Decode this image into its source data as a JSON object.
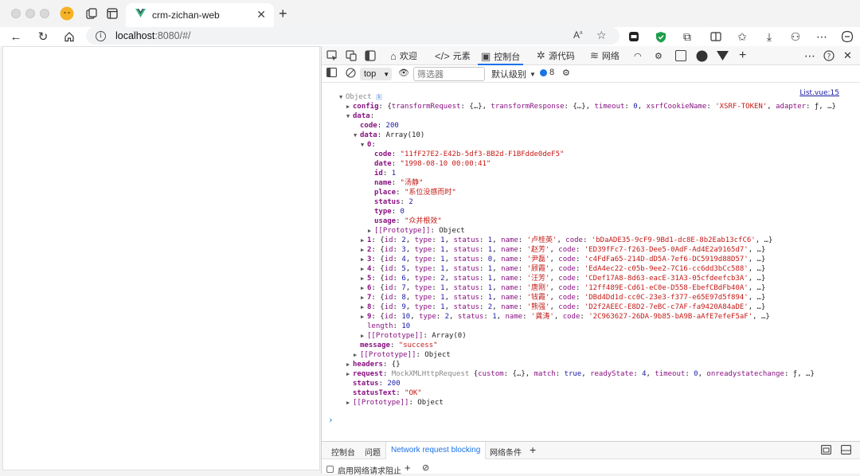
{
  "browser": {
    "tab_title": "crm-zichan-web",
    "url_host": "localhost",
    "url_rest": ":8080/#/"
  },
  "devtools": {
    "tabs": [
      {
        "label": "欢迎",
        "icon": "home-icon"
      },
      {
        "label": "元素",
        "icon": "code-icon"
      },
      {
        "label": "控制台",
        "icon": "console-icon"
      },
      {
        "label": "源代码",
        "icon": "bug-icon"
      },
      {
        "label": "网络",
        "icon": "wifi-icon"
      }
    ],
    "console_context": "top",
    "filter_placeholder": "筛选器",
    "level_label": "默认级别",
    "issue_count": "8",
    "source_link": "List.vue:15"
  },
  "console_lines": [
    {
      "indent": 0,
      "tri": "▼",
      "segs": [
        [
          "g",
          "Object "
        ],
        [
          "badge",
          "i"
        ]
      ]
    },
    {
      "indent": 1,
      "tri": "▶",
      "segs": [
        [
          "k",
          "config"
        ],
        [
          "p",
          ": {"
        ],
        [
          "kk",
          "transformRequest"
        ],
        [
          "p",
          ": {…}, "
        ],
        [
          "kk",
          "transformResponse"
        ],
        [
          "p",
          ": {…}, "
        ],
        [
          "kk",
          "timeout"
        ],
        [
          "p",
          ": "
        ],
        [
          "n",
          "0"
        ],
        [
          "p",
          ", "
        ],
        [
          "kk",
          "xsrfCookieName"
        ],
        [
          "p",
          ": "
        ],
        [
          "s",
          "'XSRF-TOKEN'"
        ],
        [
          "p",
          ", "
        ],
        [
          "kk",
          "adapter"
        ],
        [
          "p",
          ": ƒ, …}"
        ]
      ]
    },
    {
      "indent": 1,
      "tri": "▼",
      "segs": [
        [
          "k",
          "data"
        ],
        [
          "p",
          ":"
        ]
      ]
    },
    {
      "indent": 2,
      "tri": "",
      "segs": [
        [
          "k",
          "code"
        ],
        [
          "p",
          ": "
        ],
        [
          "n",
          "200"
        ]
      ]
    },
    {
      "indent": 2,
      "tri": "▼",
      "segs": [
        [
          "k",
          "data"
        ],
        [
          "p",
          ": Array(10)"
        ]
      ]
    },
    {
      "indent": 3,
      "tri": "▼",
      "segs": [
        [
          "k",
          "0"
        ],
        [
          "p",
          ":"
        ]
      ]
    },
    {
      "indent": 4,
      "tri": "",
      "segs": [
        [
          "k",
          "code"
        ],
        [
          "p",
          ": "
        ],
        [
          "s",
          "\"11fF27E2-E42b-5df3-BB2d-F1BFdde0deF5\""
        ]
      ]
    },
    {
      "indent": 4,
      "tri": "",
      "segs": [
        [
          "k",
          "date"
        ],
        [
          "p",
          ": "
        ],
        [
          "s",
          "\"1998-08-10 00:00:41\""
        ]
      ]
    },
    {
      "indent": 4,
      "tri": "",
      "segs": [
        [
          "k",
          "id"
        ],
        [
          "p",
          ": "
        ],
        [
          "n",
          "1"
        ]
      ]
    },
    {
      "indent": 4,
      "tri": "",
      "segs": [
        [
          "k",
          "name"
        ],
        [
          "p",
          ": "
        ],
        [
          "s",
          "\"汤静\""
        ]
      ]
    },
    {
      "indent": 4,
      "tri": "",
      "segs": [
        [
          "k",
          "place"
        ],
        [
          "p",
          ": "
        ],
        [
          "s",
          "\"系位没感而时\""
        ]
      ]
    },
    {
      "indent": 4,
      "tri": "",
      "segs": [
        [
          "k",
          "status"
        ],
        [
          "p",
          ": "
        ],
        [
          "n",
          "2"
        ]
      ]
    },
    {
      "indent": 4,
      "tri": "",
      "segs": [
        [
          "k",
          "type"
        ],
        [
          "p",
          ": "
        ],
        [
          "n",
          "0"
        ]
      ]
    },
    {
      "indent": 4,
      "tri": "",
      "segs": [
        [
          "k",
          "usage"
        ],
        [
          "p",
          ": "
        ],
        [
          "s",
          "\"众并根效\""
        ]
      ]
    },
    {
      "indent": 4,
      "tri": "▶",
      "segs": [
        [
          "kk",
          "[[Prototype]]"
        ],
        [
          "p",
          ": Object"
        ]
      ]
    },
    {
      "indent": 3,
      "tri": "▶",
      "segs": [
        [
          "k",
          "1"
        ],
        [
          "p",
          ": {"
        ],
        [
          "kk",
          "id"
        ],
        [
          "p",
          ": "
        ],
        [
          "n",
          "2"
        ],
        [
          "p",
          ", "
        ],
        [
          "kk",
          "type"
        ],
        [
          "p",
          ": "
        ],
        [
          "n",
          "1"
        ],
        [
          "p",
          ", "
        ],
        [
          "kk",
          "status"
        ],
        [
          "p",
          ": "
        ],
        [
          "n",
          "1"
        ],
        [
          "p",
          ", "
        ],
        [
          "kk",
          "name"
        ],
        [
          "p",
          ": "
        ],
        [
          "s",
          "'卢桂英'"
        ],
        [
          "p",
          ", "
        ],
        [
          "kk",
          "code"
        ],
        [
          "p",
          ": "
        ],
        [
          "s",
          "'bDaADE35-9cF9-9Bd1-dc8E-8b2Eab13cfC6'"
        ],
        [
          "p",
          ", …}"
        ]
      ]
    },
    {
      "indent": 3,
      "tri": "▶",
      "segs": [
        [
          "k",
          "2"
        ],
        [
          "p",
          ": {"
        ],
        [
          "kk",
          "id"
        ],
        [
          "p",
          ": "
        ],
        [
          "n",
          "3"
        ],
        [
          "p",
          ", "
        ],
        [
          "kk",
          "type"
        ],
        [
          "p",
          ": "
        ],
        [
          "n",
          "1"
        ],
        [
          "p",
          ", "
        ],
        [
          "kk",
          "status"
        ],
        [
          "p",
          ": "
        ],
        [
          "n",
          "1"
        ],
        [
          "p",
          ", "
        ],
        [
          "kk",
          "name"
        ],
        [
          "p",
          ": "
        ],
        [
          "s",
          "'赵芳'"
        ],
        [
          "p",
          ", "
        ],
        [
          "kk",
          "code"
        ],
        [
          "p",
          ": "
        ],
        [
          "s",
          "'ED39fFc7-f263-Dee5-0AdF-Ad4E2a9165d7'"
        ],
        [
          "p",
          ", …}"
        ]
      ]
    },
    {
      "indent": 3,
      "tri": "▶",
      "segs": [
        [
          "k",
          "3"
        ],
        [
          "p",
          ": {"
        ],
        [
          "kk",
          "id"
        ],
        [
          "p",
          ": "
        ],
        [
          "n",
          "4"
        ],
        [
          "p",
          ", "
        ],
        [
          "kk",
          "type"
        ],
        [
          "p",
          ": "
        ],
        [
          "n",
          "1"
        ],
        [
          "p",
          ", "
        ],
        [
          "kk",
          "status"
        ],
        [
          "p",
          ": "
        ],
        [
          "n",
          "0"
        ],
        [
          "p",
          ", "
        ],
        [
          "kk",
          "name"
        ],
        [
          "p",
          ": "
        ],
        [
          "s",
          "'尹磊'"
        ],
        [
          "p",
          ", "
        ],
        [
          "kk",
          "code"
        ],
        [
          "p",
          ": "
        ],
        [
          "s",
          "'c4FdFa65-214D-dD5A-7ef6-DC5919d88D57'"
        ],
        [
          "p",
          ", …}"
        ]
      ]
    },
    {
      "indent": 3,
      "tri": "▶",
      "segs": [
        [
          "k",
          "4"
        ],
        [
          "p",
          ": {"
        ],
        [
          "kk",
          "id"
        ],
        [
          "p",
          ": "
        ],
        [
          "n",
          "5"
        ],
        [
          "p",
          ", "
        ],
        [
          "kk",
          "type"
        ],
        [
          "p",
          ": "
        ],
        [
          "n",
          "1"
        ],
        [
          "p",
          ", "
        ],
        [
          "kk",
          "status"
        ],
        [
          "p",
          ": "
        ],
        [
          "n",
          "1"
        ],
        [
          "p",
          ", "
        ],
        [
          "kk",
          "name"
        ],
        [
          "p",
          ": "
        ],
        [
          "s",
          "'顾霞'"
        ],
        [
          "p",
          ", "
        ],
        [
          "kk",
          "code"
        ],
        [
          "p",
          ": "
        ],
        [
          "s",
          "'EdA4ec22-c05b-9ee2-7C16-cc6dd3bCc588'"
        ],
        [
          "p",
          ", …}"
        ]
      ]
    },
    {
      "indent": 3,
      "tri": "▶",
      "segs": [
        [
          "k",
          "5"
        ],
        [
          "p",
          ": {"
        ],
        [
          "kk",
          "id"
        ],
        [
          "p",
          ": "
        ],
        [
          "n",
          "6"
        ],
        [
          "p",
          ", "
        ],
        [
          "kk",
          "type"
        ],
        [
          "p",
          ": "
        ],
        [
          "n",
          "2"
        ],
        [
          "p",
          ", "
        ],
        [
          "kk",
          "status"
        ],
        [
          "p",
          ": "
        ],
        [
          "n",
          "1"
        ],
        [
          "p",
          ", "
        ],
        [
          "kk",
          "name"
        ],
        [
          "p",
          ": "
        ],
        [
          "s",
          "'汪芳'"
        ],
        [
          "p",
          ", "
        ],
        [
          "kk",
          "code"
        ],
        [
          "p",
          ": "
        ],
        [
          "s",
          "'CDef17A8-8d63-eacE-31A3-05cfdeefcb3A'"
        ],
        [
          "p",
          ", …}"
        ]
      ]
    },
    {
      "indent": 3,
      "tri": "▶",
      "segs": [
        [
          "k",
          "6"
        ],
        [
          "p",
          ": {"
        ],
        [
          "kk",
          "id"
        ],
        [
          "p",
          ": "
        ],
        [
          "n",
          "7"
        ],
        [
          "p",
          ", "
        ],
        [
          "kk",
          "type"
        ],
        [
          "p",
          ": "
        ],
        [
          "n",
          "1"
        ],
        [
          "p",
          ", "
        ],
        [
          "kk",
          "status"
        ],
        [
          "p",
          ": "
        ],
        [
          "n",
          "1"
        ],
        [
          "p",
          ", "
        ],
        [
          "kk",
          "name"
        ],
        [
          "p",
          ": "
        ],
        [
          "s",
          "'唐刚'"
        ],
        [
          "p",
          ", "
        ],
        [
          "kk",
          "code"
        ],
        [
          "p",
          ": "
        ],
        [
          "s",
          "'12ff489E-Cd61-eC0e-D558-EbefCBdFb40A'"
        ],
        [
          "p",
          ", …}"
        ]
      ]
    },
    {
      "indent": 3,
      "tri": "▶",
      "segs": [
        [
          "k",
          "7"
        ],
        [
          "p",
          ": {"
        ],
        [
          "kk",
          "id"
        ],
        [
          "p",
          ": "
        ],
        [
          "n",
          "8"
        ],
        [
          "p",
          ", "
        ],
        [
          "kk",
          "type"
        ],
        [
          "p",
          ": "
        ],
        [
          "n",
          "1"
        ],
        [
          "p",
          ", "
        ],
        [
          "kk",
          "status"
        ],
        [
          "p",
          ": "
        ],
        [
          "n",
          "1"
        ],
        [
          "p",
          ", "
        ],
        [
          "kk",
          "name"
        ],
        [
          "p",
          ": "
        ],
        [
          "s",
          "'钱霞'"
        ],
        [
          "p",
          ", "
        ],
        [
          "kk",
          "code"
        ],
        [
          "p",
          ": "
        ],
        [
          "s",
          "'DBd4Dd1d-cc0C-23e3-f377-e65E97d5f894'"
        ],
        [
          "p",
          ", …}"
        ]
      ]
    },
    {
      "indent": 3,
      "tri": "▶",
      "segs": [
        [
          "k",
          "8"
        ],
        [
          "p",
          ": {"
        ],
        [
          "kk",
          "id"
        ],
        [
          "p",
          ": "
        ],
        [
          "n",
          "9"
        ],
        [
          "p",
          ", "
        ],
        [
          "kk",
          "type"
        ],
        [
          "p",
          ": "
        ],
        [
          "n",
          "1"
        ],
        [
          "p",
          ", "
        ],
        [
          "kk",
          "status"
        ],
        [
          "p",
          ": "
        ],
        [
          "n",
          "2"
        ],
        [
          "p",
          ", "
        ],
        [
          "kk",
          "name"
        ],
        [
          "p",
          ": "
        ],
        [
          "s",
          "'熊强'"
        ],
        [
          "p",
          ", "
        ],
        [
          "kk",
          "code"
        ],
        [
          "p",
          ": "
        ],
        [
          "s",
          "'D2f2AEEC-E8D2-7eBC-c7AF-fa9420A84aDE'"
        ],
        [
          "p",
          ", …}"
        ]
      ]
    },
    {
      "indent": 3,
      "tri": "▶",
      "segs": [
        [
          "k",
          "9"
        ],
        [
          "p",
          ": {"
        ],
        [
          "kk",
          "id"
        ],
        [
          "p",
          ": "
        ],
        [
          "n",
          "10"
        ],
        [
          "p",
          ", "
        ],
        [
          "kk",
          "type"
        ],
        [
          "p",
          ": "
        ],
        [
          "n",
          "2"
        ],
        [
          "p",
          ", "
        ],
        [
          "kk",
          "status"
        ],
        [
          "p",
          ": "
        ],
        [
          "n",
          "1"
        ],
        [
          "p",
          ", "
        ],
        [
          "kk",
          "name"
        ],
        [
          "p",
          ": "
        ],
        [
          "s",
          "'龚涛'"
        ],
        [
          "p",
          ", "
        ],
        [
          "kk",
          "code"
        ],
        [
          "p",
          ": "
        ],
        [
          "s",
          "'2C963627-26DA-9b85-bA9B-aAfE7efeF5aF'"
        ],
        [
          "p",
          ", …}"
        ]
      ]
    },
    {
      "indent": 3,
      "tri": "",
      "segs": [
        [
          "kk",
          "length"
        ],
        [
          "p",
          ": "
        ],
        [
          "n",
          "10"
        ]
      ]
    },
    {
      "indent": 3,
      "tri": "▶",
      "segs": [
        [
          "kk",
          "[[Prototype]]"
        ],
        [
          "p",
          ": Array(0)"
        ]
      ]
    },
    {
      "indent": 2,
      "tri": "",
      "segs": [
        [
          "k",
          "message"
        ],
        [
          "p",
          ": "
        ],
        [
          "s",
          "\"success\""
        ]
      ]
    },
    {
      "indent": 2,
      "tri": "▶",
      "segs": [
        [
          "kk",
          "[[Prototype]]"
        ],
        [
          "p",
          ": Object"
        ]
      ]
    },
    {
      "indent": 1,
      "tri": "▶",
      "segs": [
        [
          "k",
          "headers"
        ],
        [
          "p",
          ": {}"
        ]
      ]
    },
    {
      "indent": 1,
      "tri": "▶",
      "segs": [
        [
          "k",
          "request"
        ],
        [
          "p",
          ": "
        ],
        [
          "g",
          "MockXMLHttpRequest "
        ],
        [
          "p",
          "{"
        ],
        [
          "kk",
          "custom"
        ],
        [
          "p",
          ": {…}, "
        ],
        [
          "kk",
          "match"
        ],
        [
          "p",
          ": "
        ],
        [
          "n",
          "true"
        ],
        [
          "p",
          ", "
        ],
        [
          "kk",
          "readyState"
        ],
        [
          "p",
          ": "
        ],
        [
          "n",
          "4"
        ],
        [
          "p",
          ", "
        ],
        [
          "kk",
          "timeout"
        ],
        [
          "p",
          ": "
        ],
        [
          "n",
          "0"
        ],
        [
          "p",
          ", "
        ],
        [
          "kk",
          "onreadystatechange"
        ],
        [
          "p",
          ": ƒ, …}"
        ]
      ]
    },
    {
      "indent": 1,
      "tri": "",
      "segs": [
        [
          "k",
          "status"
        ],
        [
          "p",
          ": "
        ],
        [
          "n",
          "200"
        ]
      ]
    },
    {
      "indent": 1,
      "tri": "",
      "segs": [
        [
          "k",
          "statusText"
        ],
        [
          "p",
          ": "
        ],
        [
          "s",
          "\"OK\""
        ]
      ]
    },
    {
      "indent": 1,
      "tri": "▶",
      "segs": [
        [
          "kk",
          "[[Prototype]]"
        ],
        [
          "p",
          ": Object"
        ]
      ]
    }
  ],
  "drawer": {
    "tabs": [
      "控制台",
      "问题",
      "Network request blocking",
      "网络条件"
    ],
    "active_index": 2,
    "checkbox_label": "启用网络请求阻止"
  }
}
